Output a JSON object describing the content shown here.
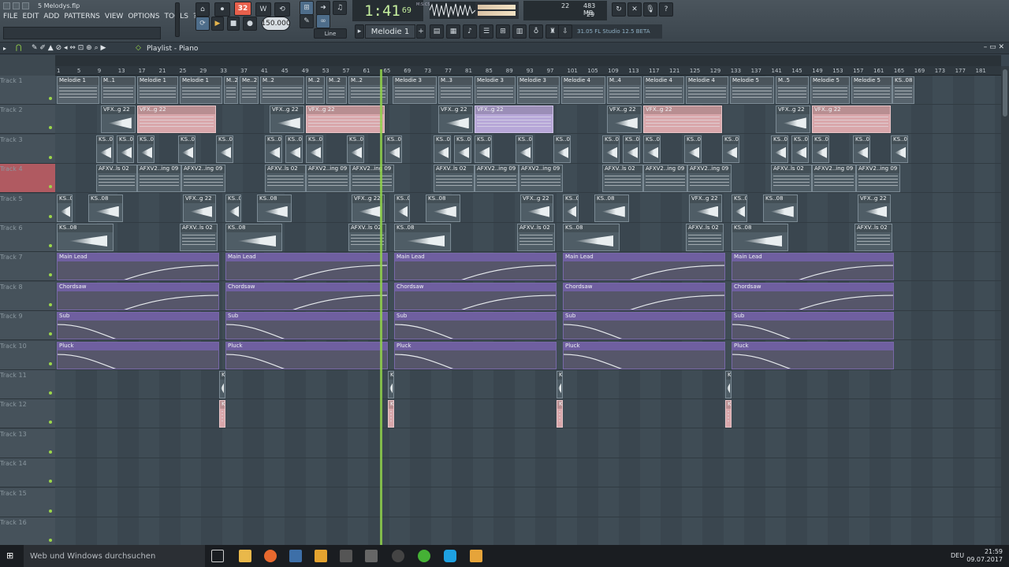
{
  "window": {
    "title": "5 Melodys.flp"
  },
  "menu": [
    "FILE",
    "EDIT",
    "ADD",
    "PATTERNS",
    "VIEW",
    "OPTIONS",
    "TOOLS",
    "?"
  ],
  "transport": {
    "time": "1:41",
    "time_small": "69",
    "time_label": "M:S:CS",
    "tempo": "150.000",
    "record_mode": "32",
    "snap": "Line"
  },
  "cpu": {
    "value": "22",
    "memory": "483 MB",
    "poly": "29"
  },
  "pattern": "Melodie 1",
  "hint": "31.05 FL Studio 12.5 BETA",
  "playlist_title": "Playlist - Piano",
  "ruler": [
    "1",
    "5",
    "9",
    "13",
    "17",
    "21",
    "25",
    "29",
    "33",
    "37",
    "41",
    "45",
    "49",
    "53",
    "57",
    "61",
    "65",
    "69",
    "73",
    "77",
    "81",
    "85",
    "89",
    "93",
    "97",
    "101",
    "105",
    "109",
    "113",
    "117",
    "121",
    "125",
    "129",
    "133",
    "137",
    "141",
    "145",
    "149",
    "153",
    "157",
    "161",
    "165",
    "169",
    "173",
    "177",
    "181"
  ],
  "tracks": [
    "Track 1",
    "Track 2",
    "Track 3",
    "Track 4",
    "Track 5",
    "Track 6",
    "Track 7",
    "Track 8",
    "Track 9",
    "Track 10",
    "Track 11",
    "Track 12",
    "Track 13",
    "Track 14",
    "Track 15",
    "Track 16"
  ],
  "clips": {
    "t1": [
      "Melodie 1",
      "M..1",
      "Melodie 1",
      "Melodie 1",
      "M..2",
      "Me..2",
      "M..2",
      "M..2",
      "M..2",
      "M..2",
      "Melodie 3",
      "M..3",
      "Melodie 3",
      "Melodie 3",
      "Melodie 4",
      "M..4",
      "Melodie 4",
      "Melodie 4",
      "Melodie 5",
      "M..5",
      "Melodie 5",
      "Melodie 5",
      "KS..08"
    ],
    "vfx": "VFX..g 22",
    "afxv_a": "AFXV..ls 02",
    "afxv_b": "AFXV2..ing 09",
    "ks": "KS..08",
    "main_lead": "Main Lead",
    "chordsaw": "Chordsaw",
    "sub": "Sub",
    "pluck": "Pluck"
  },
  "taskbar": {
    "search": "Web und Windows durchsuchen",
    "time": "21:59",
    "date": "09.07.2017",
    "lang": "DEU"
  }
}
